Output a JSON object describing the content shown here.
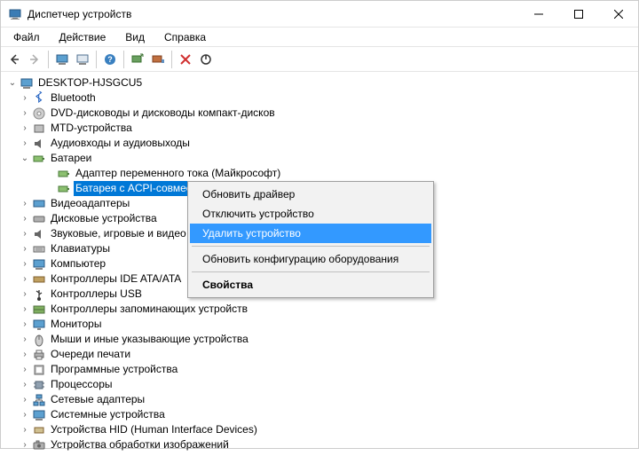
{
  "window": {
    "title": "Диспетчер устройств"
  },
  "menubar": {
    "file": "Файл",
    "action": "Действие",
    "view": "Вид",
    "help": "Справка"
  },
  "tree": {
    "root": "DESKTOP-HJSGCU5",
    "items": [
      "Bluetooth",
      "DVD-дисководы и дисководы компакт-дисков",
      "MTD-устройства",
      "Аудиовходы и аудиовыходы",
      "Батареи",
      "Видеоадаптеры",
      "Дисковые устройства",
      "Звуковые, игровые и видео",
      "Клавиатуры",
      "Компьютер",
      "Контроллеры IDE ATA/ATA",
      "Контроллеры USB",
      "Контроллеры запоминающих устройств",
      "Мониторы",
      "Мыши и иные указывающие устройства",
      "Очереди печати",
      "Программные устройства",
      "Процессоры",
      "Сетевые адаптеры",
      "Системные устройства",
      "Устройства HID (Human Interface Devices)",
      "Устройства обработки изображений"
    ],
    "battery_children": [
      "Адаптер переменного тока (Майкрософт)",
      "Батарея с ACPI-совместимым управлением (Майкрософт)"
    ]
  },
  "context_menu": {
    "update": "Обновить драйвер",
    "disable": "Отключить устройство",
    "delete": "Удалить устройство",
    "refresh": "Обновить конфигурацию оборудования",
    "properties": "Свойства"
  }
}
